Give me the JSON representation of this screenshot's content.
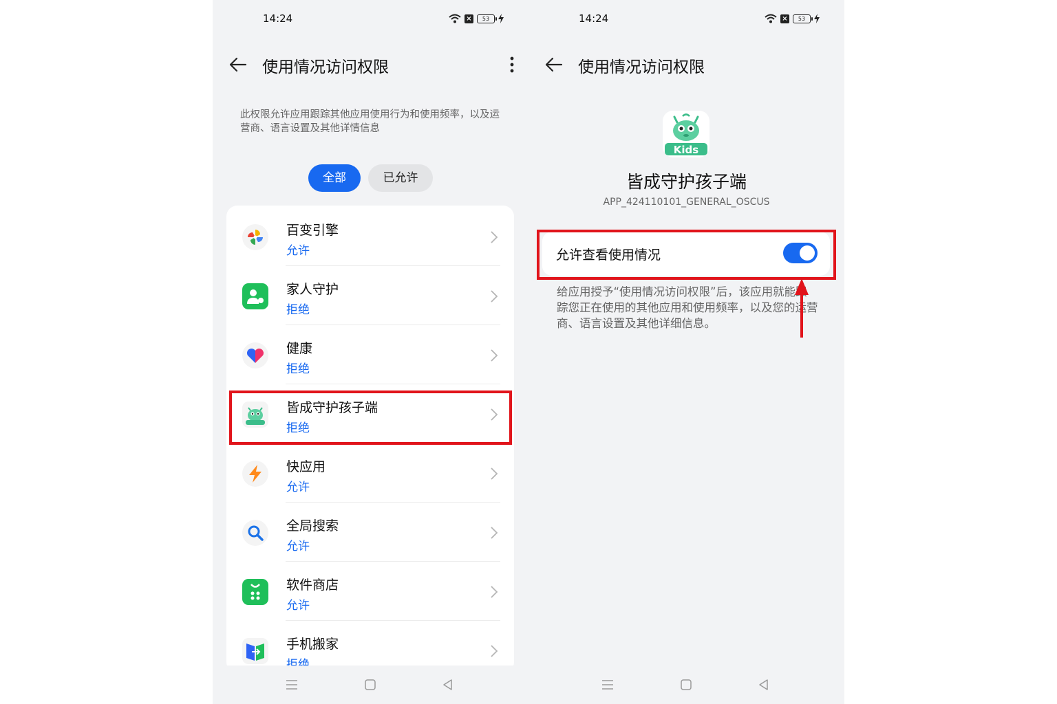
{
  "left": {
    "status_time": "14:24",
    "battery": "53",
    "title": "使用情况访问权限",
    "description": "此权限允许应用跟踪其他应用使用行为和使用频率，以及运营商、语言设置及其他详情信息",
    "tabs": [
      "全部",
      "已允许"
    ],
    "apps": [
      {
        "name": "百变引擎",
        "status": "允许",
        "icon": "pinwheel-icon"
      },
      {
        "name": "家人守护",
        "status": "拒绝",
        "icon": "family-guard-icon"
      },
      {
        "name": "健康",
        "status": "拒绝",
        "icon": "heart-icon"
      },
      {
        "name": "皆成守护孩子端",
        "status": "拒绝",
        "icon": "kids-monster-icon"
      },
      {
        "name": "快应用",
        "status": "允许",
        "icon": "lightning-icon"
      },
      {
        "name": "全局搜索",
        "status": "允许",
        "icon": "search-icon"
      },
      {
        "name": "软件商店",
        "status": "允许",
        "icon": "store-icon"
      },
      {
        "name": "手机搬家",
        "status": "拒绝",
        "icon": "phone-transfer-icon"
      }
    ]
  },
  "right": {
    "status_time": "14:24",
    "battery": "53",
    "title": "使用情况访问权限",
    "app_name": "皆成守护孩子端",
    "app_icon_label": "Kids",
    "app_id": "APP_424110101_GENERAL_OSCUS",
    "setting_label": "允许查看使用情况",
    "toggle_on": true,
    "setting_description": "给应用授予“使用情况访问权限”后，该应用就能跟踪您正在使用的其他应用和使用频率，以及您的运营商、语言设置及其他详细信息。"
  },
  "colors": {
    "accent": "#1869f0",
    "highlight": "#e1141b",
    "background": "#f2f3f5"
  }
}
